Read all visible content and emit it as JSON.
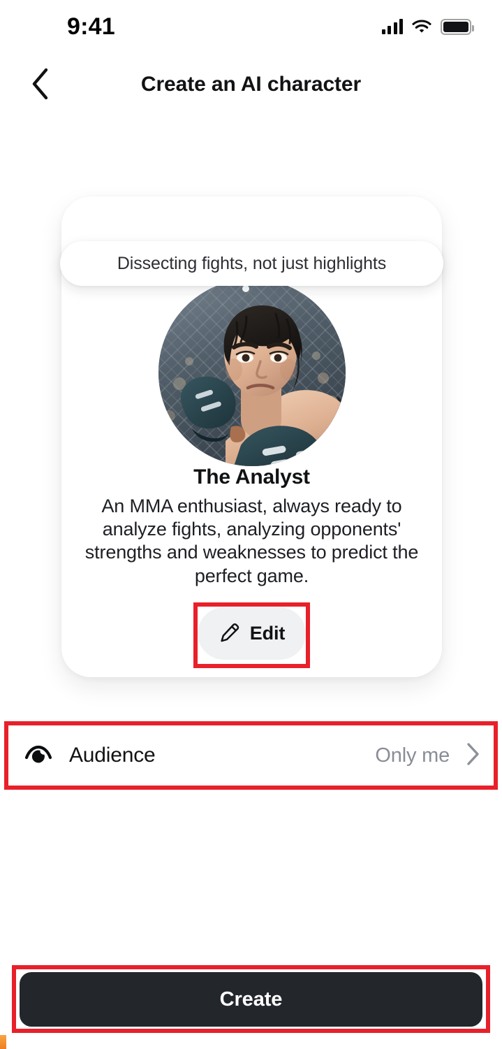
{
  "status_bar": {
    "time": "9:41",
    "cellular_icon": "cellular-bars-icon",
    "wifi_icon": "wifi-icon",
    "battery_icon": "battery-full-icon"
  },
  "nav": {
    "back_icon": "chevron-left-icon",
    "title": "Create an AI character"
  },
  "card": {
    "bubble_text": "Dissecting fights, not just highlights",
    "avatar_alt": "mma-fighter-avatar",
    "name": "The Analyst",
    "description": "An MMA enthusiast, always ready to analyze fights, analyzing opponents' strengths and weaknesses to predict the perfect game.",
    "edit_label": "Edit",
    "edit_icon": "pencil-icon"
  },
  "audience": {
    "icon": "eye-privacy-icon",
    "label": "Audience",
    "value": "Only me",
    "chevron_icon": "chevron-right-icon"
  },
  "footer": {
    "create_label": "Create"
  },
  "colors": {
    "background": "#ffffff",
    "text_primary": "#111214",
    "text_secondary": "#898d96",
    "card_surface": "#ffffff",
    "chip_surface": "#f0f1f3",
    "primary_button": "#23262b",
    "annotation": "#e8202a"
  }
}
